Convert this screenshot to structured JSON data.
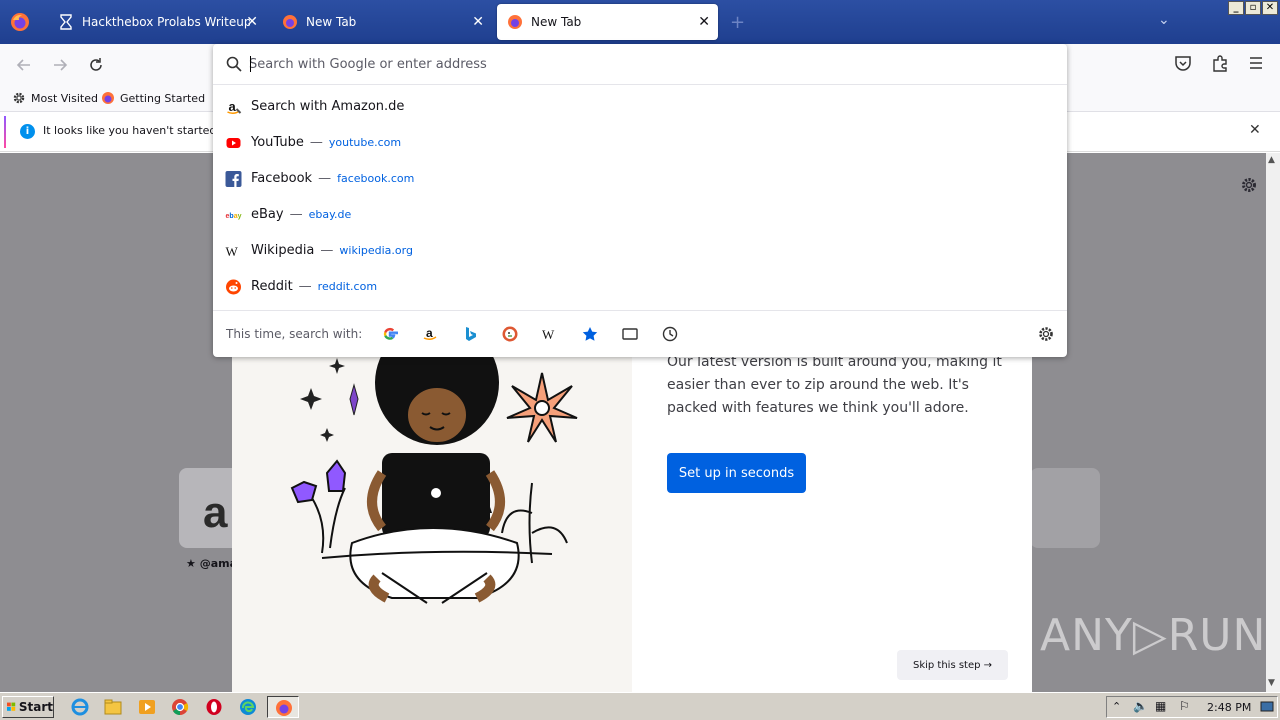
{
  "tabs": [
    {
      "title": "Hackthebox Prolabs Writeup - HTB",
      "active": false
    },
    {
      "title": "New Tab",
      "active": false
    },
    {
      "title": "New Tab",
      "active": true
    }
  ],
  "window_controls": {
    "minimize": "_",
    "maximize": "▫",
    "close": "✕"
  },
  "bookmarks": [
    {
      "label": "Most Visited",
      "icon": "gear-icon"
    },
    {
      "label": "Getting Started",
      "icon": "firefox-icon"
    }
  ],
  "notice": {
    "message": "It looks like you haven't started Fire"
  },
  "urlbar": {
    "placeholder": "Search with Google or enter address",
    "suggestions": [
      {
        "title": "Search with Amazon.de",
        "url": "",
        "icon": "amazon-icon"
      },
      {
        "title": "YouTube",
        "url": "youtube.com",
        "icon": "youtube-icon"
      },
      {
        "title": "Facebook",
        "url": "facebook.com",
        "icon": "facebook-icon"
      },
      {
        "title": "eBay",
        "url": "ebay.de",
        "icon": "ebay-icon"
      },
      {
        "title": "Wikipedia",
        "url": "wikipedia.org",
        "icon": "wikipedia-icon"
      },
      {
        "title": "Reddit",
        "url": "reddit.com",
        "icon": "reddit-icon"
      }
    ],
    "separator": "—",
    "oneoff_label": "This time, search with:",
    "engines": [
      "google-icon",
      "amazon-icon",
      "bing-icon",
      "duckduckgo-icon",
      "wikipedia-icon",
      "bookmarks-star-icon",
      "tabs-icon",
      "history-icon"
    ]
  },
  "onboarding": {
    "body": "Our latest version is built around you, making it easier than ever to zip around the web. It's packed with features we think you'll adore.",
    "primary_button": "Set up in seconds",
    "skip_button": "Skip this step →"
  },
  "tile": {
    "label": "★ @ama"
  },
  "watermark": "ANY▷RUN",
  "taskbar": {
    "start_label": "Start",
    "clock": "2:48 PM"
  },
  "colors": {
    "accent": "#0061e0",
    "tabbar": "#2c4fa3",
    "content_dim": "#8e8d91"
  }
}
